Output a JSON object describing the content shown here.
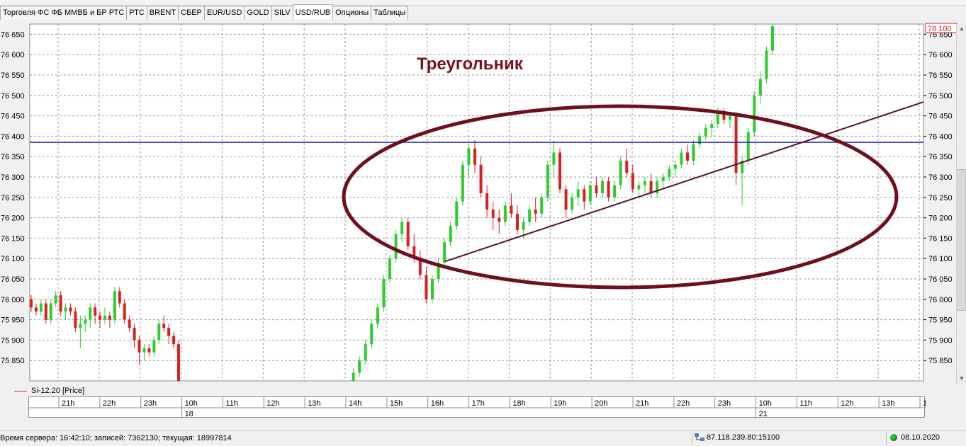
{
  "tabs": [
    {
      "label": "Торговля ФС ФБ ММВБ и БР РТС",
      "active": false
    },
    {
      "label": "РТС",
      "active": false
    },
    {
      "label": "BRENT",
      "active": false
    },
    {
      "label": "СБЕР",
      "active": false
    },
    {
      "label": "EUR/USD",
      "active": false
    },
    {
      "label": "GOLD",
      "active": false
    },
    {
      "label": "SILV",
      "active": false
    },
    {
      "label": "USD/RUB",
      "active": true
    },
    {
      "label": "Опционы",
      "active": false
    },
    {
      "label": "Таблицы",
      "active": false
    }
  ],
  "chart": {
    "annotation": "Треугольник",
    "annotation_color": "#7a1020",
    "last_price_label": "78 100",
    "up_color": "#2ecc2e",
    "down_color": "#d92020",
    "level_line_color": "#1a1ab0",
    "trend_color": "#5a1030"
  },
  "chart_data": {
    "type": "candlestick",
    "series_name": "Si-12.20 [Price]",
    "ylim": [
      75800,
      76675
    ],
    "y_ticks": [
      76650,
      76600,
      76550,
      76500,
      76450,
      76400,
      76350,
      76300,
      76250,
      76200,
      76150,
      76100,
      76050,
      76000,
      75950,
      75900,
      75850
    ],
    "y_tick_labels": [
      "76 650",
      "76 600",
      "76 550",
      "76 500",
      "76 450",
      "76 400",
      "76 350",
      "76 300",
      "76 250",
      "76 200",
      "76 150",
      "76 100",
      "76 050",
      "76 000",
      "75 950",
      "75 900",
      "75 850"
    ],
    "horizontal_level": 76385,
    "x_labels": [
      "21h",
      "22h",
      "23h",
      "10h",
      "11h",
      "12h",
      "13h",
      "14h",
      "15h",
      "16h",
      "17h",
      "18h",
      "19h",
      "20h",
      "21h",
      "22h",
      "23h",
      "10h",
      "11h",
      "12h",
      "13h",
      "14h"
    ],
    "day_labels": [
      {
        "after_label": 3,
        "text": "18"
      },
      {
        "after_label": 17,
        "text": "21"
      }
    ],
    "candles": [
      [
        76000,
        76010,
        75970,
        75980
      ],
      [
        75980,
        75990,
        75960,
        75970
      ],
      [
        75970,
        76000,
        75960,
        75990
      ],
      [
        75990,
        76000,
        75940,
        75950
      ],
      [
        75950,
        76000,
        75940,
        75990
      ],
      [
        75990,
        76020,
        75980,
        76010
      ],
      [
        76010,
        76020,
        75960,
        75970
      ],
      [
        75970,
        75990,
        75950,
        75980
      ],
      [
        75980,
        75990,
        75960,
        75970
      ],
      [
        75970,
        75980,
        75920,
        75930
      ],
      [
        75930,
        75960,
        75880,
        75940
      ],
      [
        75940,
        75960,
        75920,
        75950
      ],
      [
        75950,
        75990,
        75930,
        75980
      ],
      [
        75980,
        75990,
        75940,
        75960
      ],
      [
        75960,
        75970,
        75930,
        75950
      ],
      [
        75950,
        75980,
        75940,
        75960
      ],
      [
        75960,
        75970,
        75930,
        75950
      ],
      [
        75950,
        76030,
        75940,
        76020
      ],
      [
        76020,
        76030,
        75980,
        75990
      ],
      [
        75990,
        76000,
        75940,
        75950
      ],
      [
        75950,
        75960,
        75920,
        75930
      ],
      [
        75930,
        75940,
        75880,
        75900
      ],
      [
        75900,
        75910,
        75840,
        75870
      ],
      [
        75870,
        75890,
        75850,
        75880
      ],
      [
        75880,
        75890,
        75860,
        75870
      ],
      [
        75870,
        75910,
        75860,
        75900
      ],
      [
        75900,
        75950,
        75890,
        75940
      ],
      [
        75940,
        75960,
        75920,
        75930
      ],
      [
        75930,
        75940,
        75890,
        75910
      ],
      [
        75910,
        75920,
        75880,
        75890
      ],
      [
        75890,
        75900,
        75780,
        75790
      ],
      [
        75780,
        75800,
        75750,
        75790
      ],
      [
        75790,
        75830,
        75780,
        75820
      ],
      [
        75820,
        75860,
        75810,
        75850
      ],
      [
        75850,
        75900,
        75840,
        75890
      ],
      [
        75890,
        75950,
        75880,
        75940
      ],
      [
        75940,
        75990,
        75930,
        75980
      ],
      [
        75980,
        76060,
        75970,
        76050
      ],
      [
        76050,
        76110,
        76040,
        76100
      ],
      [
        76100,
        76170,
        76090,
        76160
      ],
      [
        76160,
        76200,
        76140,
        76190
      ],
      [
        76190,
        76200,
        76120,
        76130
      ],
      [
        76130,
        76160,
        76090,
        76100
      ],
      [
        76100,
        76120,
        76050,
        76060
      ],
      [
        76060,
        76080,
        75990,
        76000
      ],
      [
        76000,
        76060,
        75990,
        76050
      ],
      [
        76050,
        76100,
        76040,
        76090
      ],
      [
        76090,
        76150,
        76080,
        76140
      ],
      [
        76140,
        76190,
        76130,
        76180
      ],
      [
        76180,
        76250,
        76170,
        76240
      ],
      [
        76240,
        76340,
        76230,
        76330
      ],
      [
        76330,
        76380,
        76300,
        76370
      ],
      [
        76370,
        76390,
        76310,
        76330
      ],
      [
        76330,
        76350,
        76250,
        76260
      ],
      [
        76260,
        76280,
        76200,
        76220
      ],
      [
        76220,
        76240,
        76170,
        76200
      ],
      [
        76200,
        76220,
        76160,
        76190
      ],
      [
        76190,
        76240,
        76180,
        76230
      ],
      [
        76230,
        76260,
        76200,
        76210
      ],
      [
        76210,
        76230,
        76160,
        76170
      ],
      [
        76170,
        76200,
        76150,
        76190
      ],
      [
        76190,
        76230,
        76180,
        76220
      ],
      [
        76220,
        76250,
        76190,
        76210
      ],
      [
        76210,
        76260,
        76200,
        76250
      ],
      [
        76250,
        76340,
        76240,
        76330
      ],
      [
        76330,
        76390,
        76300,
        76360
      ],
      [
        76360,
        76370,
        76260,
        76270
      ],
      [
        76270,
        76280,
        76200,
        76220
      ],
      [
        76220,
        76260,
        76210,
        76250
      ],
      [
        76250,
        76290,
        76230,
        76270
      ],
      [
        76270,
        76280,
        76220,
        76240
      ],
      [
        76240,
        76290,
        76230,
        76280
      ],
      [
        76280,
        76300,
        76250,
        76260
      ],
      [
        76260,
        76300,
        76250,
        76290
      ],
      [
        76290,
        76300,
        76240,
        76250
      ],
      [
        76250,
        76290,
        76240,
        76280
      ],
      [
        76280,
        76350,
        76270,
        76340
      ],
      [
        76340,
        76370,
        76300,
        76310
      ],
      [
        76310,
        76330,
        76260,
        76270
      ],
      [
        76270,
        76290,
        76250,
        76280
      ],
      [
        76280,
        76300,
        76260,
        76290
      ],
      [
        76290,
        76310,
        76250,
        76260
      ],
      [
        76260,
        76300,
        76250,
        76290
      ],
      [
        76290,
        76310,
        76270,
        76300
      ],
      [
        76300,
        76330,
        76290,
        76320
      ],
      [
        76320,
        76340,
        76300,
        76330
      ],
      [
        76330,
        76370,
        76320,
        76360
      ],
      [
        76360,
        76380,
        76330,
        76340
      ],
      [
        76340,
        76390,
        76330,
        76380
      ],
      [
        76380,
        76410,
        76370,
        76400
      ],
      [
        76400,
        76430,
        76390,
        76420
      ],
      [
        76420,
        76440,
        76400,
        76430
      ],
      [
        76430,
        76470,
        76420,
        76460
      ],
      [
        76460,
        76470,
        76430,
        76440
      ],
      [
        76440,
        76460,
        76420,
        76450
      ],
      [
        76450,
        76460,
        76280,
        76310
      ],
      [
        76310,
        76350,
        76230,
        76340
      ],
      [
        76340,
        76420,
        76330,
        76410
      ],
      [
        76410,
        76510,
        76400,
        76500
      ],
      [
        76500,
        76560,
        76480,
        76540
      ],
      [
        76540,
        76620,
        76530,
        76610
      ],
      [
        76610,
        76680,
        76600,
        76670
      ]
    ]
  },
  "status": {
    "server_time": "Время сервера: 16:42:10; записей: 7362130; текущая: 18997814",
    "connection": "87.118.239.80:15100",
    "date": "08.10.2020"
  }
}
